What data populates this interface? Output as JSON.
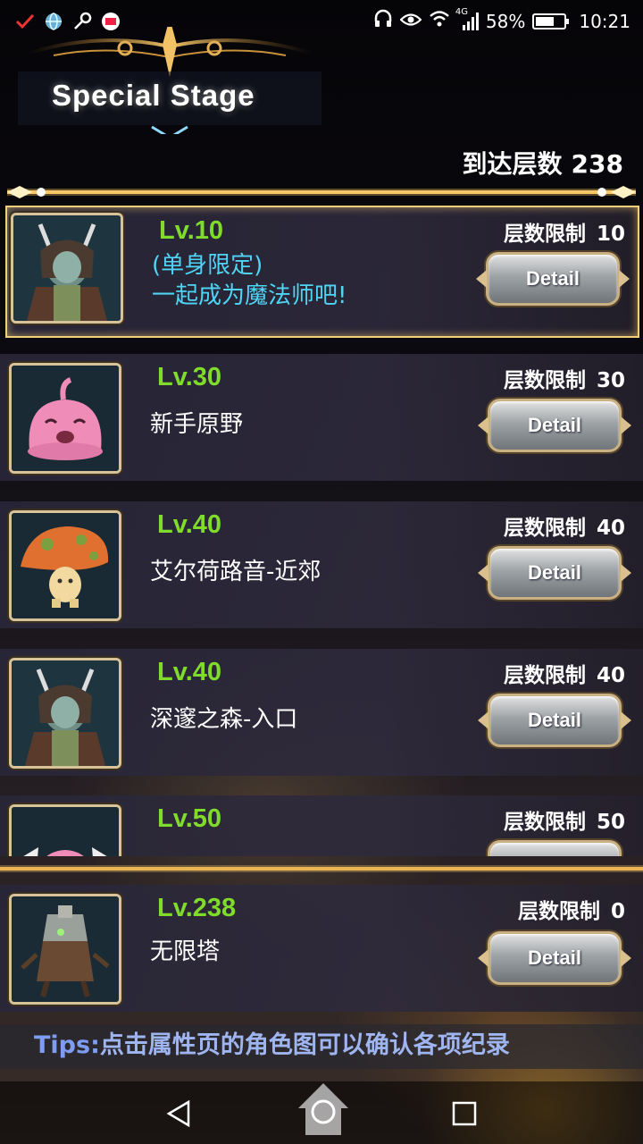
{
  "status_bar": {
    "battery_percent": "58%",
    "network": "4G",
    "time": "10:21",
    "left_icons": [
      "notification-check-icon",
      "globe-icon",
      "key-icon",
      "news-app-icon"
    ],
    "right_icons": [
      "headset-icon",
      "eye-icon",
      "wifi-icon",
      "signal-icon",
      "battery-icon"
    ]
  },
  "header": {
    "title": "Special Stage",
    "reach_label": "到达层数",
    "reach_value": "238"
  },
  "stages": [
    {
      "level": "Lv.10",
      "name_line1": "(单身限定)",
      "name_line2": "一起成为魔法师吧!",
      "limit_label": "层数限制",
      "limit_value": "10",
      "button": "Detail",
      "portrait": "horned-warrior-portrait",
      "selected": true
    },
    {
      "level": "Lv.30",
      "name": "新手原野",
      "limit_label": "层数限制",
      "limit_value": "30",
      "button": "Detail",
      "portrait": "pink-slime-portrait"
    },
    {
      "level": "Lv.40",
      "name": "艾尔荷路音-近郊",
      "limit_label": "层数限制",
      "limit_value": "40",
      "button": "Detail",
      "portrait": "mushroom-portrait"
    },
    {
      "level": "Lv.40",
      "name": "深邃之森-入口",
      "limit_label": "层数限制",
      "limit_value": "40",
      "button": "Detail",
      "portrait": "horned-warrior-portrait"
    },
    {
      "level": "Lv.50",
      "limit_label": "层数限制",
      "limit_value": "50",
      "portrait": "winged-slime-portrait"
    }
  ],
  "pinned_stage": {
    "level": "Lv.238",
    "name": "无限塔",
    "limit_label": "层数限制",
    "limit_value": "0",
    "button": "Detail",
    "portrait": "tree-spirit-portrait"
  },
  "tips": {
    "key": "Tips:",
    "text": "点击属性页的角色图可以确认各项纪录"
  },
  "nav": [
    "back-icon",
    "home-icon",
    "recents-icon"
  ],
  "colors": {
    "level_green": "#7fdc2a",
    "accent_gold": "#f3cf7a",
    "name_cyan": "#4fd4f5",
    "tips_blue": "#7e9cf2"
  }
}
